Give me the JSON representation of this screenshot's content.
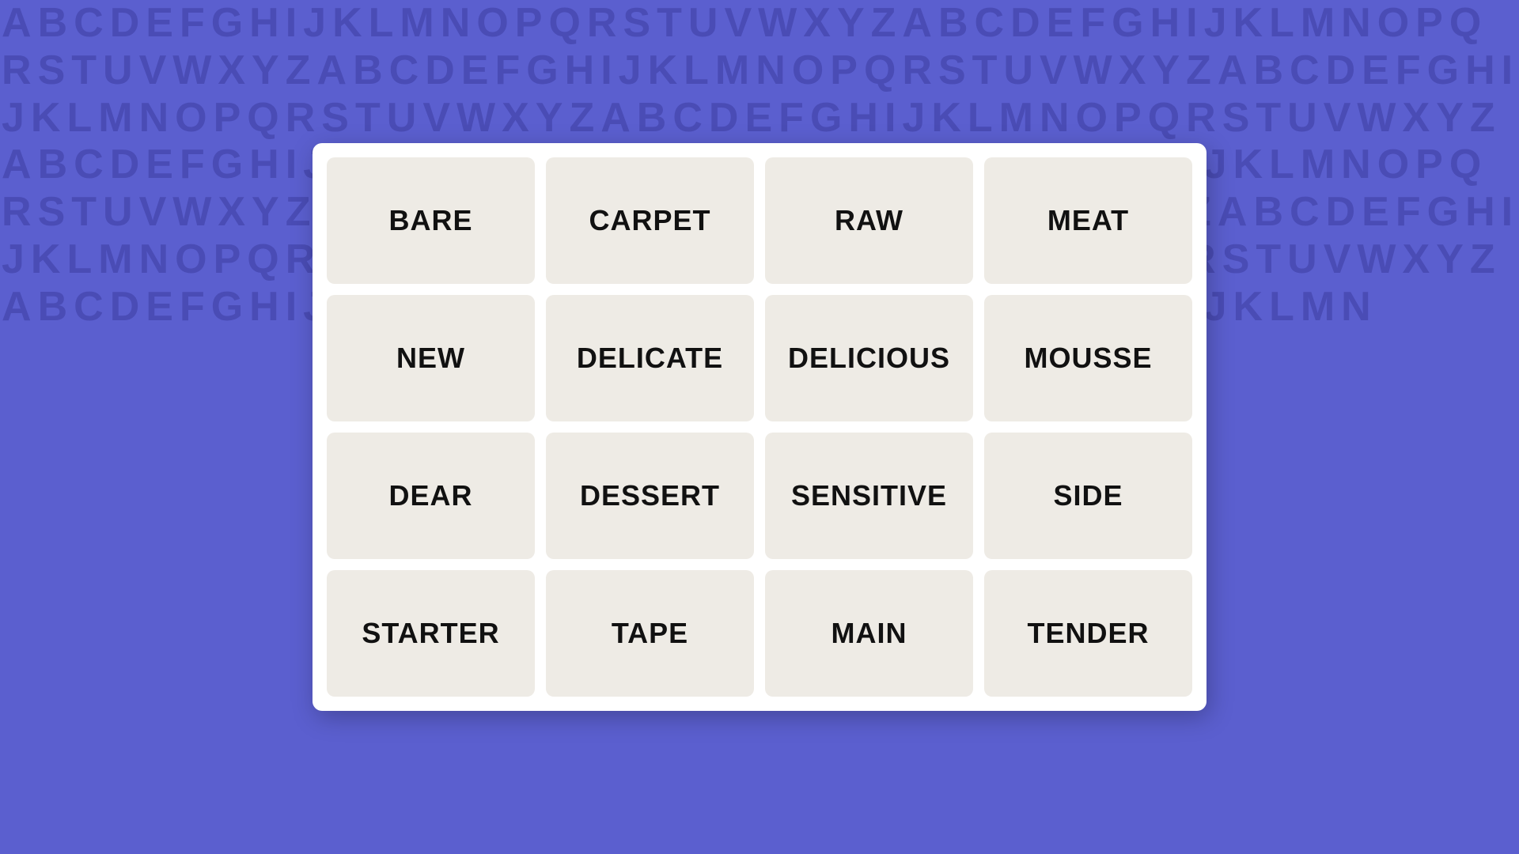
{
  "background": {
    "color": "#5b5fcf",
    "letter_sequence": "ABCDEFGHIJKLMNOPQRSTUVWXYZ"
  },
  "panel": {
    "words": [
      {
        "id": "bare",
        "label": "BARE"
      },
      {
        "id": "carpet",
        "label": "CARPET"
      },
      {
        "id": "raw",
        "label": "RAW"
      },
      {
        "id": "meat",
        "label": "MEAT"
      },
      {
        "id": "new",
        "label": "NEW"
      },
      {
        "id": "delicate",
        "label": "DELICATE"
      },
      {
        "id": "delicious",
        "label": "DELICIOUS"
      },
      {
        "id": "mousse",
        "label": "MOUSSE"
      },
      {
        "id": "dear",
        "label": "DEAR"
      },
      {
        "id": "dessert",
        "label": "DESSERT"
      },
      {
        "id": "sensitive",
        "label": "SENSITIVE"
      },
      {
        "id": "side",
        "label": "SIDE"
      },
      {
        "id": "starter",
        "label": "STARTER"
      },
      {
        "id": "tape",
        "label": "TAPE"
      },
      {
        "id": "main",
        "label": "MAIN"
      },
      {
        "id": "tender",
        "label": "TENDER"
      }
    ]
  }
}
